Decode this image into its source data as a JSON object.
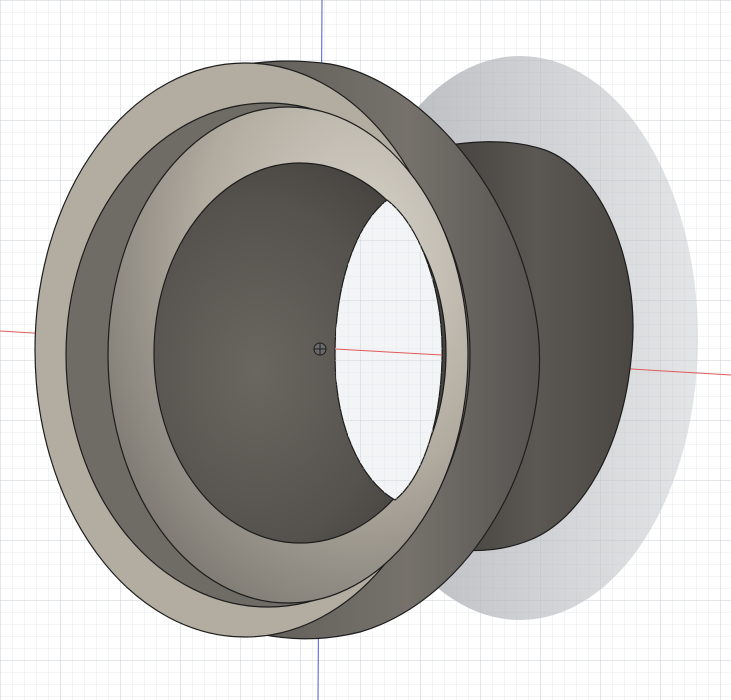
{
  "viewport": {
    "background_color": "#ffffff",
    "grid_minor_color": "#e6e9ee",
    "grid_major_color": "#c9ced6",
    "x_axis_color": "#e05a5a",
    "y_axis_color": "#4a5fd0"
  },
  "model": {
    "kind": "flanged cylindrical sleeve",
    "face_color": "#b3ada1",
    "dark_color": "#5e5b56",
    "mid_color": "#8f8a82",
    "edge_color": "#1d1d1d",
    "shadow_color": "#bfc2c6"
  },
  "origin_marker": {
    "icon": "origin-icon"
  }
}
